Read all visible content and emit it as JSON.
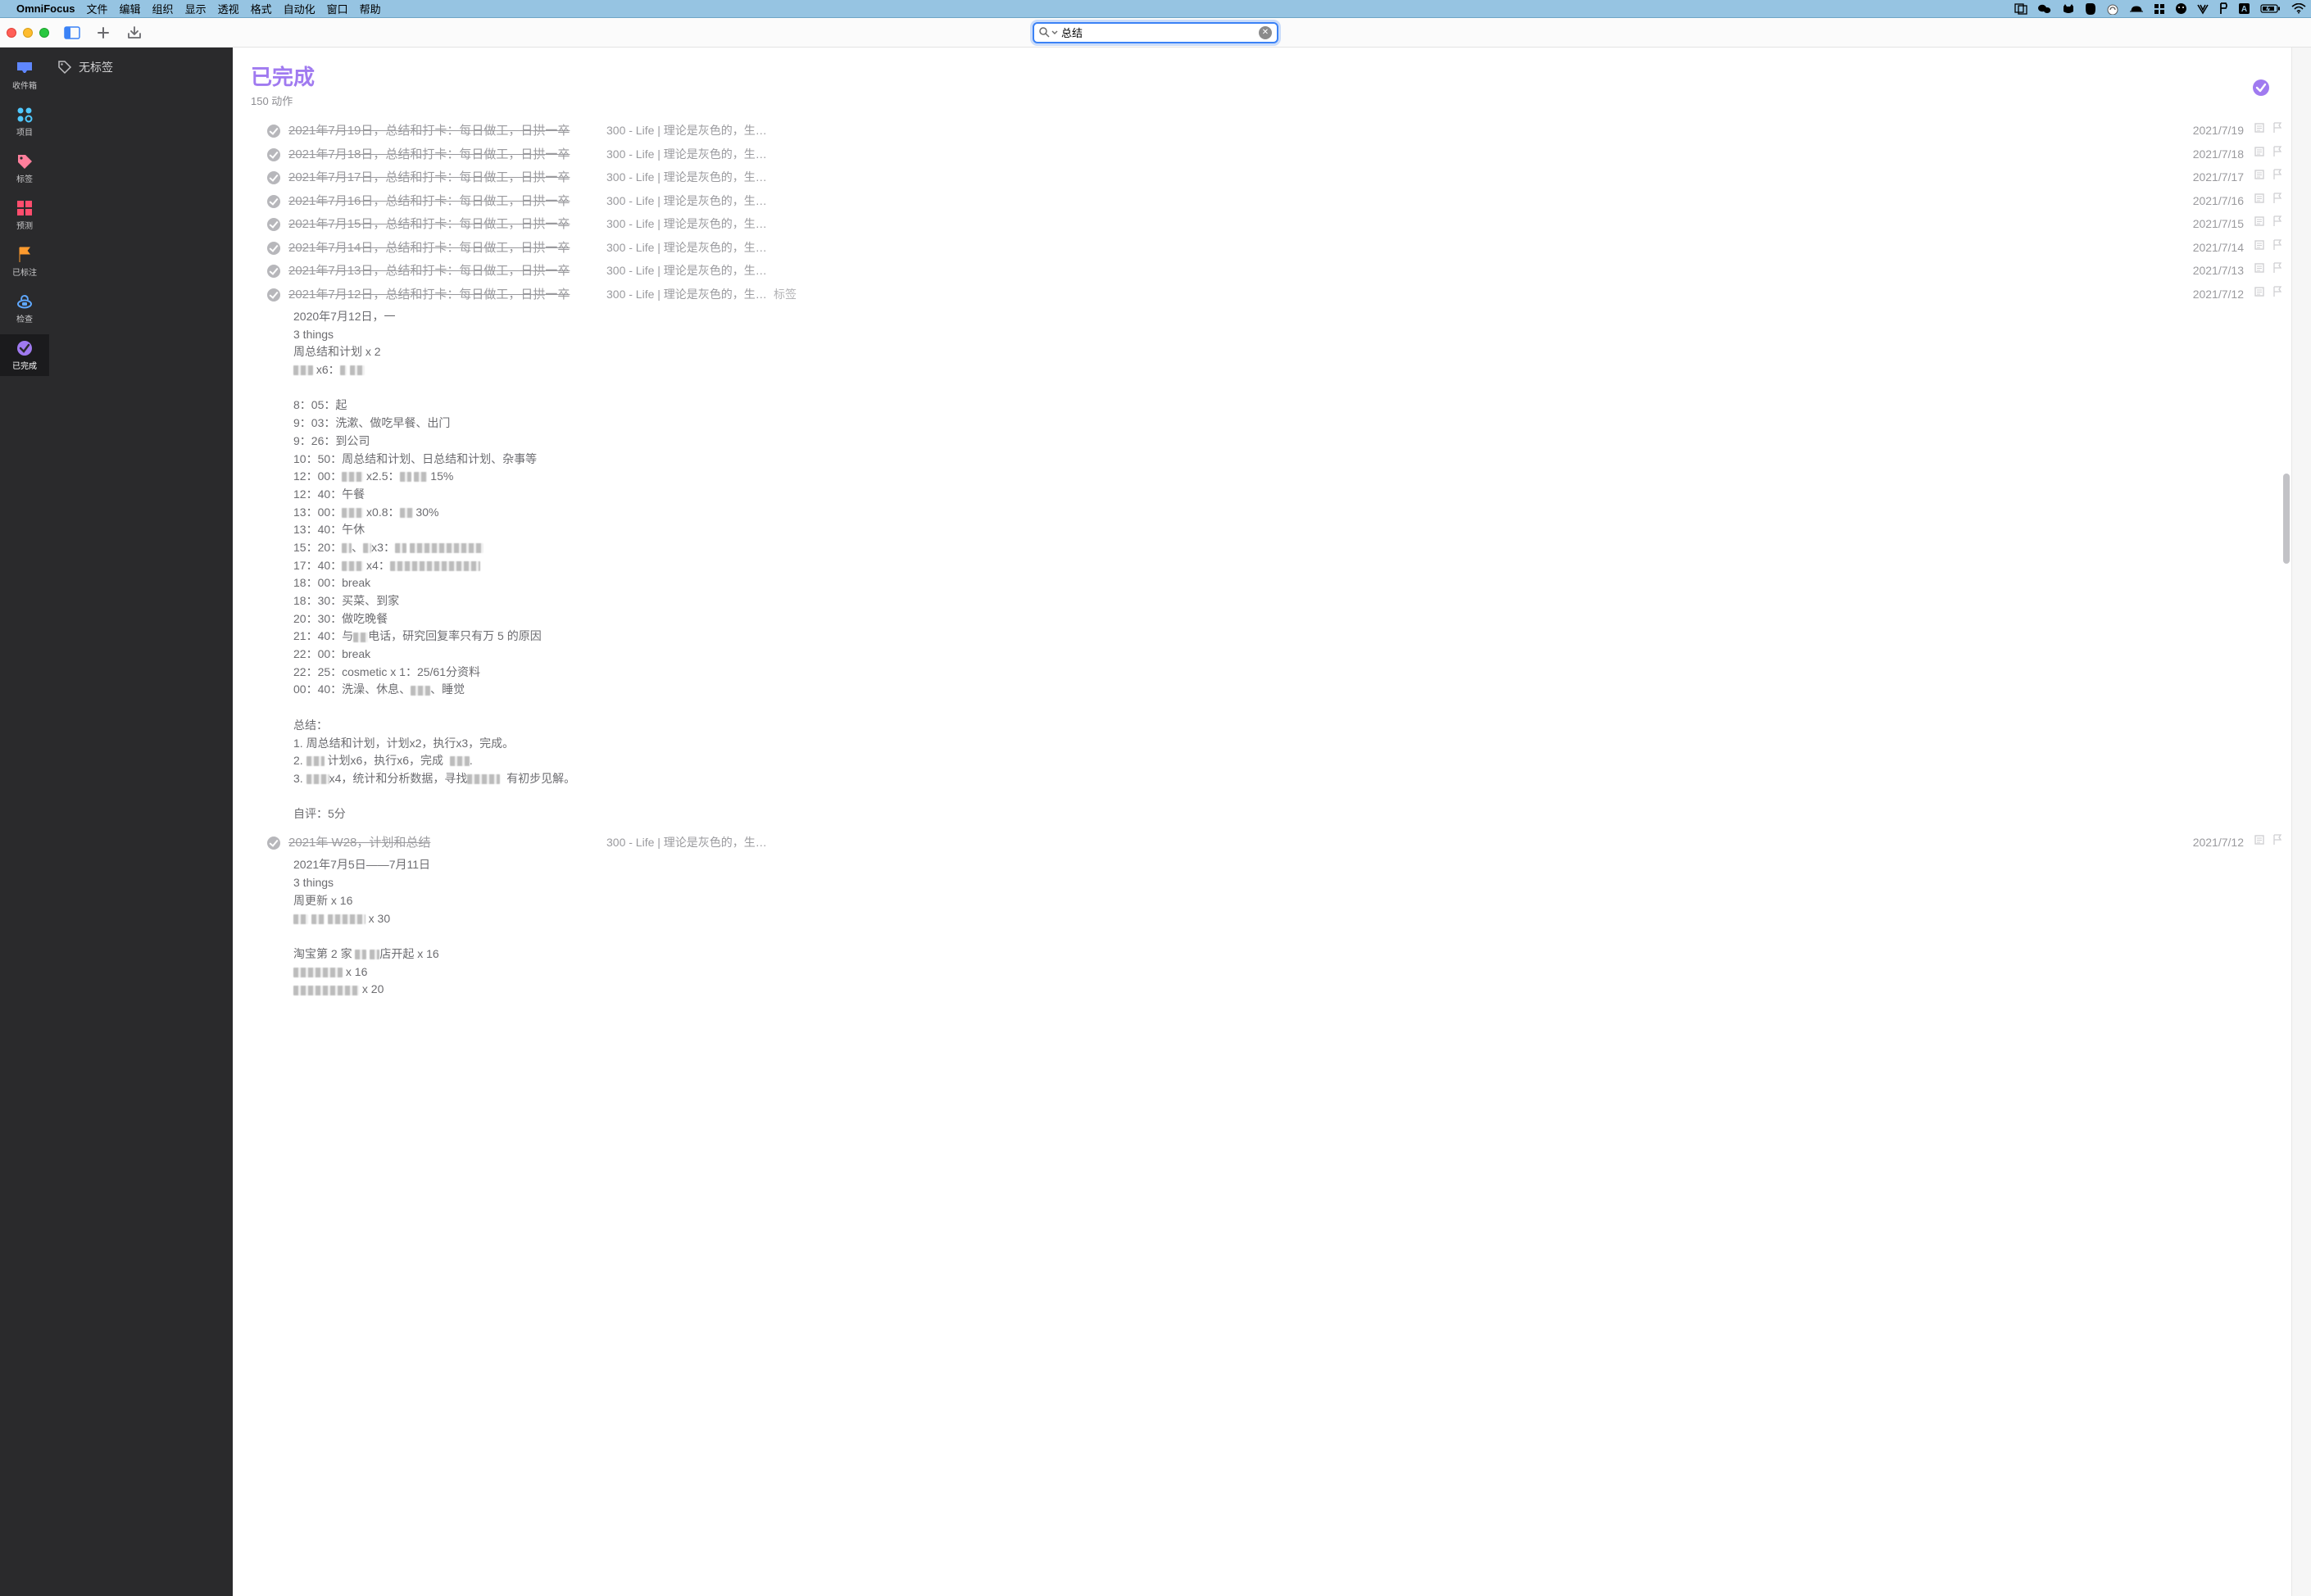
{
  "menubar": {
    "app_name": "OmniFocus",
    "menus": [
      "文件",
      "编辑",
      "组织",
      "显示",
      "透视",
      "格式",
      "自动化",
      "窗口",
      "帮助"
    ]
  },
  "toolbar": {
    "search_value": "总结"
  },
  "leftnav": [
    {
      "key": "inbox",
      "label": "收件箱",
      "color": "#5f87ff",
      "active": false
    },
    {
      "key": "projects",
      "label": "项目",
      "color": "#4fc8ff",
      "active": false
    },
    {
      "key": "tags",
      "label": "标签",
      "color": "#ff7f9c",
      "active": false
    },
    {
      "key": "forecast",
      "label": "预测",
      "color": "#ff4d6d",
      "active": false
    },
    {
      "key": "flagged",
      "label": "已标注",
      "color": "#ff9b2e",
      "active": false
    },
    {
      "key": "review",
      "label": "检查",
      "color": "#5fa8ff",
      "active": false
    },
    {
      "key": "completed",
      "label": "已完成",
      "color": "#a07af0",
      "active": true
    }
  ],
  "tags_panel": {
    "no_tags_label": "无标签"
  },
  "perspective": {
    "title": "已完成",
    "subtitle": "150 动作"
  },
  "tasks": [
    {
      "title": "2021年7月19日，总结和打卡：每日做工，日拱一卒",
      "project": "300 - Life | 理论是灰色的，生活…",
      "date": "2021/7/19",
      "has_note": true,
      "flag": true,
      "tags": ""
    },
    {
      "title": "2021年7月18日，总结和打卡：每日做工，日拱一卒",
      "project": "300 - Life | 理论是灰色的，生活…",
      "date": "2021/7/18",
      "has_note": true,
      "flag": true,
      "tags": ""
    },
    {
      "title": "2021年7月17日，总结和打卡：每日做工，日拱一卒",
      "project": "300 - Life | 理论是灰色的，生活…",
      "date": "2021/7/17",
      "has_note": true,
      "flag": true,
      "tags": ""
    },
    {
      "title": "2021年7月16日，总结和打卡：每日做工，日拱一卒",
      "project": "300 - Life | 理论是灰色的，生活…",
      "date": "2021/7/16",
      "has_note": true,
      "flag": true,
      "tags": ""
    },
    {
      "title": "2021年7月15日，总结和打卡：每日做工，日拱一卒",
      "project": "300 - Life | 理论是灰色的，生活…",
      "date": "2021/7/15",
      "has_note": true,
      "flag": true,
      "tags": ""
    },
    {
      "title": "2021年7月14日，总结和打卡：每日做工，日拱一卒",
      "project": "300 - Life | 理论是灰色的，生活…",
      "date": "2021/7/14",
      "has_note": true,
      "flag": true,
      "tags": ""
    },
    {
      "title": "2021年7月13日，总结和打卡：每日做工，日拱一卒",
      "project": "300 - Life | 理论是灰色的，生活…",
      "date": "2021/7/13",
      "has_note": true,
      "flag": true,
      "tags": ""
    },
    {
      "title": "2021年7月12日，总结和打卡：每日做工，日拱一卒",
      "project": "300 - Life | 理论是灰色的，生活…",
      "date": "2021/7/12",
      "has_note": true,
      "flag": true,
      "tags": "标签",
      "expanded": true,
      "note": [
        {
          "t": "2020年7月12日，一"
        },
        {
          "t": "3 things"
        },
        {
          "t": "周总结和计划 x 2"
        },
        {
          "seg": [
            {
              "c": 24
            },
            {
              "t": " x6："
            },
            {
              "c": 8
            },
            {
              "t": " "
            },
            {
              "c": 18
            }
          ]
        },
        {
          "t": ""
        },
        {
          "t": "8：05：起"
        },
        {
          "t": "9：03：洗漱、做吃早餐、出门"
        },
        {
          "t": "9：26：到公司"
        },
        {
          "t": "10：50：周总结和计划、日总结和计划、杂事等"
        },
        {
          "seg": [
            {
              "t": "12：00："
            },
            {
              "c": 26
            },
            {
              "t": " x2.5："
            },
            {
              "c": 14
            },
            {
              "t": " "
            },
            {
              "c": 16
            },
            {
              "t": " 15%"
            }
          ]
        },
        {
          "t": "12：40：午餐"
        },
        {
          "seg": [
            {
              "t": "13：00："
            },
            {
              "c": 26
            },
            {
              "t": " x0.8："
            },
            {
              "c": 16
            },
            {
              "t": " 30%"
            }
          ]
        },
        {
          "t": "13：40：午休"
        },
        {
          "seg": [
            {
              "t": "15：20："
            },
            {
              "c": 12
            },
            {
              "t": "、"
            },
            {
              "c": 10
            },
            {
              "t": "x3："
            },
            {
              "c": 14
            },
            {
              "t": " "
            },
            {
              "c": 90
            }
          ]
        },
        {
          "seg": [
            {
              "t": "17：40："
            },
            {
              "c": 26
            },
            {
              "t": " x4："
            },
            {
              "c": 110
            }
          ]
        },
        {
          "t": "18：00：break"
        },
        {
          "t": "18：30：买菜、到家"
        },
        {
          "t": "20：30：做吃晚餐"
        },
        {
          "seg": [
            {
              "t": "21：40：与"
            },
            {
              "c": 18
            },
            {
              "t": "电话，研究回复率只有万 5 的原因"
            }
          ]
        },
        {
          "t": "22：00：break"
        },
        {
          "t": "22：25：cosmetic x 1：25/61分资料"
        },
        {
          "seg": [
            {
              "t": "00：40：洗澡、休息、"
            },
            {
              "c": 24
            },
            {
              "t": "、睡觉"
            }
          ]
        },
        {
          "t": ""
        },
        {
          "t": "总结："
        },
        {
          "t": "1. 周总结和计划，计划x2，执行x3，完成。"
        },
        {
          "seg": [
            {
              "t": "2. "
            },
            {
              "c": 22
            },
            {
              "t": " 计划x6，执行x6，完成  "
            },
            {
              "c": 24
            },
            {
              "t": "."
            }
          ]
        },
        {
          "seg": [
            {
              "t": "3. "
            },
            {
              "c": 28
            },
            {
              "t": "x4，统计和分析数据，寻找"
            },
            {
              "c": 40
            },
            {
              "t": "  有初步见解。"
            }
          ]
        },
        {
          "t": ""
        },
        {
          "t": "自评：5分"
        }
      ]
    },
    {
      "title": "2021年 W28，计划和总结",
      "project": "300 - Life | 理论是灰色的，生活…",
      "date": "2021/7/12",
      "has_note": true,
      "flag": true,
      "tags": "",
      "expanded": true,
      "note": [
        {
          "t": "2021年7月5日——7月11日"
        },
        {
          "t": "3 things"
        },
        {
          "t": "周更新 x 16"
        },
        {
          "seg": [
            {
              "c": 18
            },
            {
              "t": " "
            },
            {
              "c": 16
            },
            {
              "t": " "
            },
            {
              "c": 46
            },
            {
              "t": " x 30"
            }
          ]
        },
        {
          "t": ""
        },
        {
          "seg": [
            {
              "t": "淘宝第 2 家 "
            },
            {
              "c": 14
            },
            {
              "t": " "
            },
            {
              "c": 12
            },
            {
              "t": "店开起 x 16"
            }
          ]
        },
        {
          "seg": [
            {
              "c": 60
            },
            {
              "t": " x 16"
            }
          ]
        },
        {
          "seg": [
            {
              "c": 80
            },
            {
              "t": " x 20"
            }
          ]
        }
      ]
    }
  ]
}
